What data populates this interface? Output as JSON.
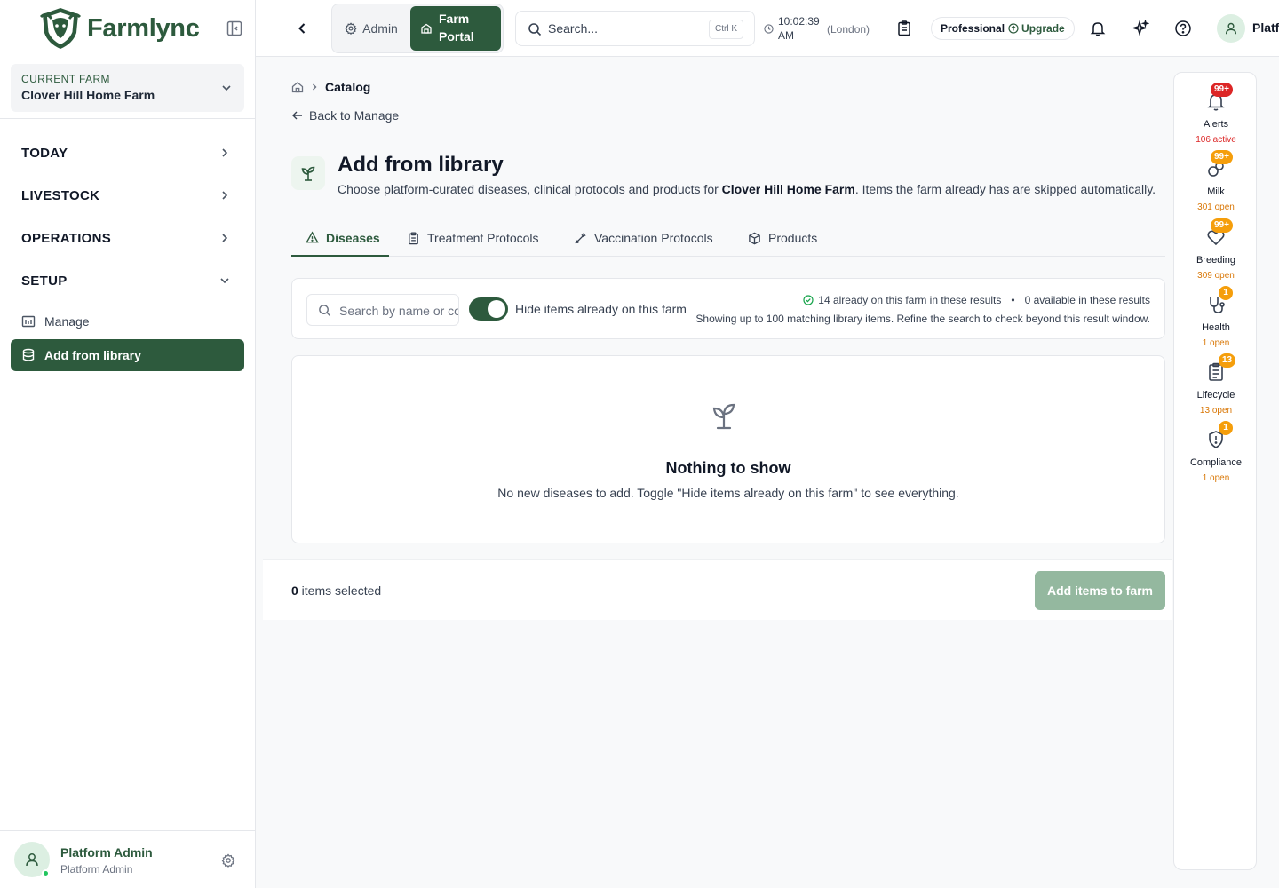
{
  "brand": {
    "name": "Farmlync"
  },
  "farm_selector": {
    "label": "CURRENT FARM",
    "name": "Clover Hill Home Farm"
  },
  "nav": {
    "sections": [
      {
        "label": "TODAY",
        "chevron": "chevron-right-icon"
      },
      {
        "label": "LIVESTOCK",
        "chevron": "chevron-right-icon"
      },
      {
        "label": "OPERATIONS",
        "chevron": "chevron-right-icon"
      },
      {
        "label": "SETUP",
        "chevron": "chevron-down-icon"
      }
    ],
    "setup_items": [
      {
        "label": "Manage",
        "icon": "manage-icon",
        "active": false
      },
      {
        "label": "Add from library",
        "icon": "database-icon",
        "active": true
      }
    ]
  },
  "user": {
    "name": "Platform Admin",
    "role": "Platform Admin"
  },
  "header": {
    "admin_label": "Admin",
    "portal_label": "Farm Portal",
    "search_placeholder": "Search...",
    "search_shortcut": "Ctrl K",
    "time": "10:02:39 AM",
    "timezone": "(London)",
    "plan_name": "Professional",
    "upgrade_label": "Upgrade",
    "user_name_truncated": "Platf"
  },
  "breadcrumb": {
    "current": "Catalog"
  },
  "back_link": "Back to Manage",
  "page": {
    "title": "Add from library",
    "subtitle_before": "Choose platform-curated diseases, clinical protocols and products for ",
    "subtitle_farm": "Clover Hill Home Farm",
    "subtitle_after": ". Items the farm already has are skipped automatically."
  },
  "tabs": [
    {
      "label": "Diseases",
      "icon": "alert-triangle-icon",
      "active": true
    },
    {
      "label": "Treatment Protocols",
      "icon": "clipboard-icon",
      "active": false
    },
    {
      "label": "Vaccination Protocols",
      "icon": "syringe-icon",
      "active": false
    },
    {
      "label": "Products",
      "icon": "package-icon",
      "active": false
    }
  ],
  "filters": {
    "search_placeholder": "Search by name or code",
    "toggle_label": "Hide items already on this farm",
    "toggle_on": true,
    "already_on_farm": "14 already on this farm in these results",
    "available": "0 available in these results",
    "note": "Showing up to 100 matching library items. Refine the search to check beyond this result window."
  },
  "empty_state": {
    "title": "Nothing to show",
    "text": "No new diseases to add. Toggle \"Hide items already on this farm\" to see everything."
  },
  "selection": {
    "count": "0",
    "suffix": " items selected",
    "button": "Add items to farm"
  },
  "rail": [
    {
      "label": "Alerts",
      "badge": "99+",
      "sub": "106 active",
      "tone": "red"
    },
    {
      "label": "Milk",
      "badge": "99+",
      "sub": "301 open",
      "tone": "amber"
    },
    {
      "label": "Breeding",
      "badge": "99+",
      "sub": "309 open",
      "tone": "amber"
    },
    {
      "label": "Health",
      "badge": "1",
      "sub": "1 open",
      "tone": "amber"
    },
    {
      "label": "Lifecycle",
      "badge": "13",
      "sub": "13 open",
      "tone": "amber"
    },
    {
      "label": "Compliance",
      "badge": "1",
      "sub": "1 open",
      "tone": "amber"
    }
  ],
  "colors": {
    "brand_green": "#2d5a3d",
    "alert_red": "#dc2626",
    "badge_amber": "#f59e0b"
  }
}
